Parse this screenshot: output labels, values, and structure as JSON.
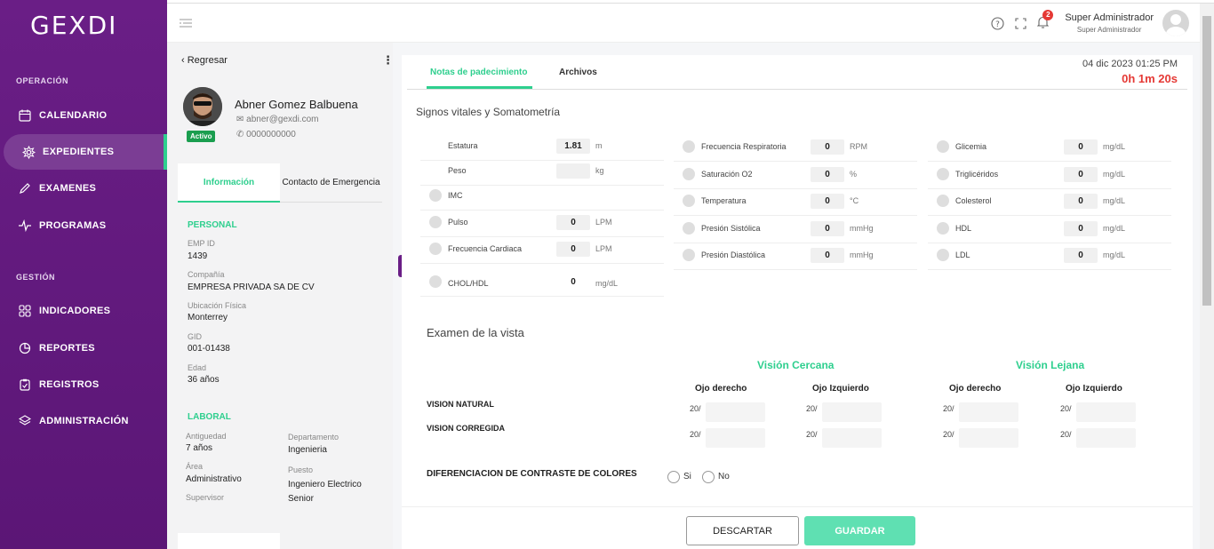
{
  "app": {
    "logo": "GEXDI"
  },
  "sidebar": {
    "section_operacion": "OPERACIÓN",
    "section_gestion": "GESTIÓN",
    "items": [
      {
        "label": "CALENDARIO",
        "icon": "calendar-icon"
      },
      {
        "label": "EXPEDIENTES",
        "icon": "medical-icon",
        "active": true
      },
      {
        "label": "EXAMENES",
        "icon": "pencil-icon"
      },
      {
        "label": "PROGRAMAS",
        "icon": "pulse-icon"
      },
      {
        "label": "INDICADORES",
        "icon": "grid-icon"
      },
      {
        "label": "REPORTES",
        "icon": "pie-chart-icon"
      },
      {
        "label": "REGISTROS",
        "icon": "clipboard-icon"
      },
      {
        "label": "ADMINISTRACIÓN",
        "icon": "layers-icon"
      }
    ]
  },
  "header": {
    "user_name": "Super Administrador",
    "user_role": "Super Administrador",
    "notifications": "2"
  },
  "patient": {
    "back": "Regresar",
    "name": "Abner Gomez Balbuena",
    "email": "abner@gexdi.com",
    "phone": "0000000000",
    "status": "Activo",
    "tabs": [
      "Información",
      "Contacto de Emergencia"
    ],
    "personal_title": "PERSONAL",
    "emp_id_label": "EMP ID",
    "emp_id": "1439",
    "company_label": "Compañía",
    "company": "EMPRESA PRIVADA SA DE CV",
    "location_label": "Ubicación Física",
    "location": "Monterrey",
    "gid_label": "GID",
    "gid": "001-01438",
    "age_label": "Edad",
    "age": "36 años",
    "laboral_title": "LABORAL",
    "antiguedad_label": "Antiguedad",
    "antiguedad": "7 años",
    "departamento_label": "Departamento",
    "departamento": "Ingenieria",
    "area_label": "Área",
    "area": "Administrativo",
    "puesto_label": "Puesto",
    "puesto": "Ingeniero Electrico Senior",
    "supervisor_label": "Supervisor"
  },
  "main": {
    "tabs": [
      "Notas de padecimiento",
      "Archivos"
    ],
    "datetime": "04 dic 2023 01:25 PM",
    "timer": "0h 1m 20s",
    "signs_title": "Signos vitales y Somatometría",
    "col1": [
      {
        "label": "Estatura",
        "value": "1.81",
        "unit": "m"
      },
      {
        "label": "Peso",
        "value": "",
        "unit": "kg"
      },
      {
        "label": "IMC",
        "value": "",
        "unit": ""
      },
      {
        "label": "Pulso",
        "value": "0",
        "unit": "LPM"
      },
      {
        "label": "Frecuencia Cardiaca",
        "value": "0",
        "unit": "LPM"
      },
      {
        "label": "CHOL/HDL",
        "value": "0",
        "unit": "mg/dL"
      }
    ],
    "col2": [
      {
        "label": "Frecuencia Respiratoria",
        "value": "0",
        "unit": "RPM"
      },
      {
        "label": "Saturación O2",
        "value": "0",
        "unit": "%"
      },
      {
        "label": "Temperatura",
        "value": "0",
        "unit": "°C"
      },
      {
        "label": "Presión Sistólica",
        "value": "0",
        "unit": "mmHg"
      },
      {
        "label": "Presión Diastólica",
        "value": "0",
        "unit": "mmHg"
      }
    ],
    "col3": [
      {
        "label": "Glicemia",
        "value": "0",
        "unit": "mg/dL"
      },
      {
        "label": "Triglicéridos",
        "value": "0",
        "unit": "mg/dL"
      },
      {
        "label": "Colesterol",
        "value": "0",
        "unit": "mg/dL"
      },
      {
        "label": "HDL",
        "value": "0",
        "unit": "mg/dL"
      },
      {
        "label": "LDL",
        "value": "0",
        "unit": "mg/dL"
      }
    ],
    "vista_title": "Examen de la vista",
    "vision_cercana": "Visión Cercana",
    "vision_lejana": "Visión Lejana",
    "ojo_derecho": "Ojo derecho",
    "ojo_izquierdo": "Ojo Izquierdo",
    "vision_natural": "VISION NATURAL",
    "vision_corregida": "VISION CORREGIDA",
    "fraction": "20/",
    "contraste": "DIFERENCIACION DE CONTRASTE DE COLORES",
    "si": "Si",
    "no": "No"
  },
  "footer": {
    "discard": "DESCARTAR",
    "save": "GUARDAR"
  },
  "colors": {
    "sidebar": "#6a1e86",
    "accent": "#2ecf8e",
    "timer": "#e53935"
  }
}
